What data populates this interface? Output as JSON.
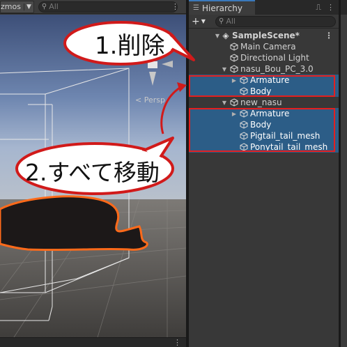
{
  "scene_view": {
    "gizmos_label": "zmos",
    "gizmos_caret": "▼",
    "search_placeholder": "All",
    "persp_label": "< Persp"
  },
  "hierarchy": {
    "tab_label": "Hierarchy",
    "tab_icon": "list-icon",
    "lock_glyph": "🔒",
    "menu_glyph": "⋮",
    "add_button": "+",
    "add_caret": "▼",
    "search_placeholder": "All",
    "scene": {
      "name": "SampleScene*",
      "menu": "⋮"
    },
    "items": [
      {
        "label": "Main Camera",
        "depth": 1,
        "arrow": "",
        "selected": false
      },
      {
        "label": "Directional Light",
        "depth": 1,
        "arrow": "",
        "selected": false
      },
      {
        "label": "nasu_Bou_PC_3.0",
        "depth": 1,
        "arrow": "▼",
        "selected": false
      },
      {
        "label": "Armature",
        "depth": 2,
        "arrow": "▶",
        "selected": true
      },
      {
        "label": "Body",
        "depth": 2,
        "arrow": "",
        "selected": true
      },
      {
        "label": "new_nasu",
        "depth": 1,
        "arrow": "▼",
        "selected": false
      },
      {
        "label": "Armature",
        "depth": 2,
        "arrow": "▶",
        "selected": true
      },
      {
        "label": "Body",
        "depth": 2,
        "arrow": "",
        "selected": true
      },
      {
        "label": "Pigtail_tail_mesh",
        "depth": 2,
        "arrow": "",
        "selected": true
      },
      {
        "label": "Ponytail_tail_mesh",
        "depth": 2,
        "arrow": "",
        "selected": true
      }
    ]
  },
  "callouts": {
    "delete": "1.削除",
    "move_all": "2.すべて移動"
  },
  "colors": {
    "selection": "#2c5d87",
    "highlight_red": "#e41f1f",
    "tab_accent": "#3a79bb",
    "mesh_outline": "#ff6a1a"
  }
}
